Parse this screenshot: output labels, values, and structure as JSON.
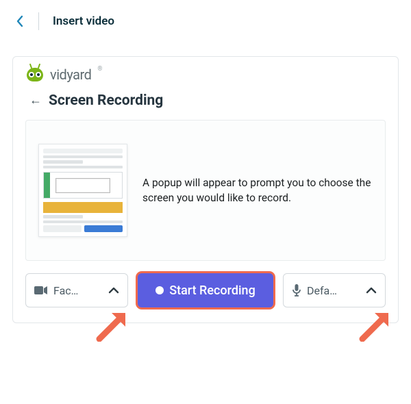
{
  "topbar": {
    "title": "Insert video"
  },
  "brand": {
    "name": "vidyard",
    "registered": "®"
  },
  "subheader": {
    "label": "Screen Recording"
  },
  "content": {
    "description": "A popup will appear to prompt you to choose the screen you would like to record."
  },
  "controls": {
    "camera": {
      "label": "Fac…"
    },
    "record": {
      "label": "Start Recording"
    },
    "mic": {
      "label": "Defa…"
    }
  },
  "colors": {
    "primary": "#5b5ee0",
    "highlight": "#ef6a4e",
    "brand_green": "#7cb518"
  }
}
